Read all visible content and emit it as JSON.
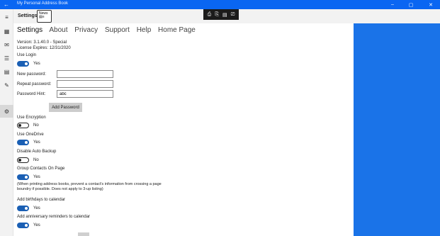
{
  "window": {
    "title": "My Personal Address Book",
    "back_icon": "←",
    "minimize": "–",
    "maximize": "▢",
    "close": "✕"
  },
  "header": {
    "page_title": "Settings",
    "logo_text": "News\n▤≡"
  },
  "toolbar": {
    "icons": [
      "⎙",
      "⎘",
      "▤",
      "⎚"
    ]
  },
  "rail": {
    "icons": [
      "≡",
      "▦",
      "✉",
      "☰",
      "▤",
      "✎",
      "⚙"
    ]
  },
  "nav": {
    "items": [
      "Settings",
      "About",
      "Privacy",
      "Support",
      "Help",
      "Home Page"
    ]
  },
  "version": "Version: 3.1.40.0 - Special",
  "license": "License Expires:   12/31/2020",
  "use_login": {
    "label": "Use Login",
    "state": "Yes",
    "on": true
  },
  "password": {
    "new_label": "New password:",
    "new_value": "",
    "repeat_label": "Repeat password:",
    "repeat_value": "",
    "hint_label": "Password Hint:",
    "hint_value": "abc",
    "add_button": "Add Password"
  },
  "use_encryption": {
    "label": "Use Encryption",
    "state": "No",
    "on": false
  },
  "use_onedrive": {
    "label": "Use OneDrive",
    "state": "Yes",
    "on": true
  },
  "disable_backup": {
    "label": "Disable Auto Backup",
    "state": "No",
    "on": false
  },
  "group_contacts": {
    "label": "Group Contacts On Page",
    "state": "Yes",
    "on": true,
    "note": "(When printing address books, prevent a contact's information from crossing a page boundry if possible. Does not apply to 3-up listing)"
  },
  "birthdays": {
    "label": "Add birthdays to calendar",
    "state": "Yes",
    "on": true
  },
  "anniversary": {
    "label": "Add anniversary reminders to calendar",
    "state": "Yes",
    "on": true
  },
  "colors": {
    "titlebar": "#0a66f2",
    "accent_panel": "#1a73e8",
    "toggle_on": "#1a5fb4"
  }
}
